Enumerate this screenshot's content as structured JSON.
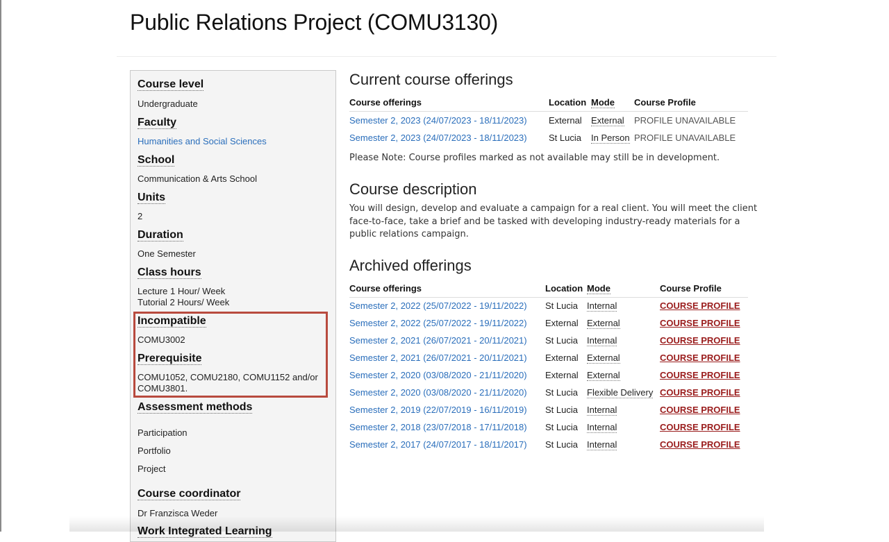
{
  "page": {
    "title": "Public Relations Project (COMU3130)"
  },
  "sidebar": {
    "course_level": {
      "label": "Course level",
      "value": "Undergraduate"
    },
    "faculty": {
      "label": "Faculty",
      "value": "Humanities and Social Sciences"
    },
    "school": {
      "label": "School",
      "value": "Communication & Arts School"
    },
    "units": {
      "label": "Units",
      "value": "2"
    },
    "duration": {
      "label": "Duration",
      "value": "One Semester"
    },
    "class_hours": {
      "label": "Class hours",
      "line1": "Lecture 1 Hour/ Week",
      "line2": "Tutorial 2 Hours/ Week"
    },
    "incompatible": {
      "label": "Incompatible",
      "value": "COMU3002"
    },
    "prerequisite": {
      "label": "Prerequisite",
      "line1": "COMU1052, COMU2180, COMU1152 and/or",
      "line2": "COMU3801."
    },
    "assessment": {
      "label": "Assessment methods",
      "items": [
        "Participation",
        "Portfolio",
        "Project"
      ]
    },
    "coordinator": {
      "label": "Course coordinator",
      "value": "Dr Franzisca Weder"
    },
    "wil": {
      "label": "Work Integrated Learning"
    }
  },
  "current": {
    "title": "Current course offerings",
    "headers": {
      "offerings": "Course offerings",
      "location": "Location",
      "mode": "Mode",
      "profile": "Course Profile"
    },
    "rows": [
      {
        "offering": "Semester 2, 2023 (24/07/2023 - 18/11/2023)",
        "location": "External",
        "mode": "External",
        "profile": "PROFILE UNAVAILABLE"
      },
      {
        "offering": "Semester 2, 2023 (24/07/2023 - 18/11/2023)",
        "location": "St Lucia",
        "mode": "In Person",
        "profile": "PROFILE UNAVAILABLE"
      }
    ],
    "note": "Please Note: Course profiles marked as not available may still be in development."
  },
  "description": {
    "title": "Course description",
    "text": "You will design, develop and evaluate a campaign for a real client. You will meet the client face-to-face, take a brief and be tasked with developing industry-ready materials for a public relations campaign."
  },
  "archived": {
    "title": "Archived offerings",
    "headers": {
      "offerings": "Course offerings",
      "location": "Location",
      "mode": "Mode",
      "profile": "Course Profile"
    },
    "rows": [
      {
        "offering": "Semester 2, 2022 (25/07/2022 - 19/11/2022)",
        "location": "St Lucia",
        "mode": "Internal",
        "profile": "COURSE PROFILE"
      },
      {
        "offering": "Semester 2, 2022 (25/07/2022 - 19/11/2022)",
        "location": "External",
        "mode": "External",
        "profile": "COURSE PROFILE"
      },
      {
        "offering": "Semester 2, 2021 (26/07/2021 - 20/11/2021)",
        "location": "St Lucia",
        "mode": "Internal",
        "profile": "COURSE PROFILE"
      },
      {
        "offering": "Semester 2, 2021 (26/07/2021 - 20/11/2021)",
        "location": "External",
        "mode": "External",
        "profile": "COURSE PROFILE"
      },
      {
        "offering": "Semester 2, 2020 (03/08/2020 - 21/11/2020)",
        "location": "External",
        "mode": "External",
        "profile": "COURSE PROFILE"
      },
      {
        "offering": "Semester 2, 2020 (03/08/2020 - 21/11/2020)",
        "location": "St Lucia",
        "mode": "Flexible Delivery",
        "profile": "COURSE PROFILE"
      },
      {
        "offering": "Semester 2, 2019 (22/07/2019 - 16/11/2019)",
        "location": "St Lucia",
        "mode": "Internal",
        "profile": "COURSE PROFILE"
      },
      {
        "offering": "Semester 2, 2018 (23/07/2018 - 17/11/2018)",
        "location": "St Lucia",
        "mode": "Internal",
        "profile": "COURSE PROFILE"
      },
      {
        "offering": "Semester 2, 2017 (24/07/2017 - 18/11/2017)",
        "location": "St Lucia",
        "mode": "Internal",
        "profile": "COURSE PROFILE"
      }
    ]
  },
  "colors": {
    "link": "#2a6ebb",
    "profile_link": "#9a1c1c",
    "highlight_border": "#b84a3e",
    "sidebar_bg": "#f4f4f4"
  }
}
